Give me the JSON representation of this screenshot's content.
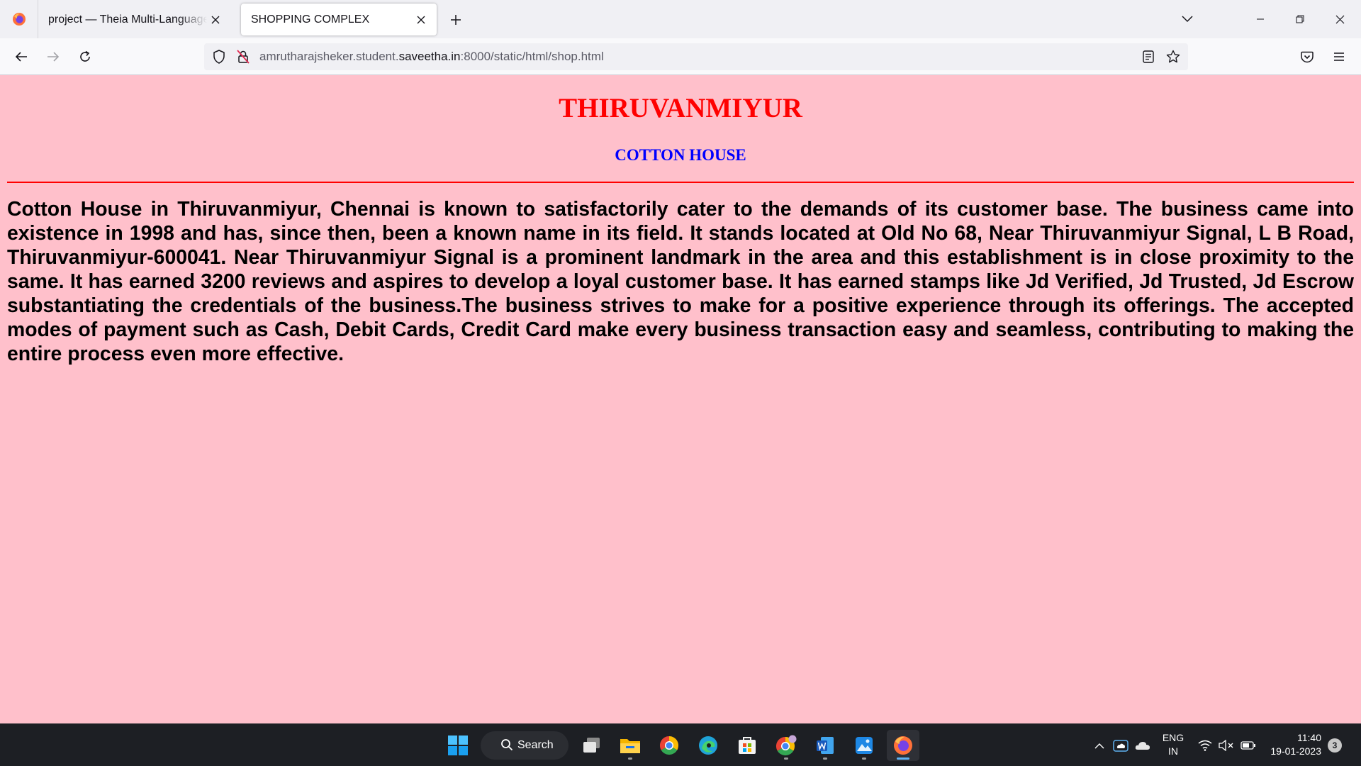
{
  "browser": {
    "tabs": [
      {
        "label": "project — Theia Multi-Language Ex",
        "active": false
      },
      {
        "label": "SHOPPING COMPLEX",
        "active": true
      }
    ],
    "url": {
      "prefix": "amrutharajsheker.student.",
      "domain": "saveetha.in",
      "suffix": ":8000/static/html/shop.html"
    }
  },
  "page": {
    "heading": "THIRUVANMIYUR",
    "subheading": "COTTON HOUSE",
    "body": "Cotton House in Thiruvanmiyur, Chennai is known to satisfactorily cater to the demands of its customer base. The business came into existence in 1998 and has, since then, been a known name in its field. It stands located at Old No 68, Near Thiruvanmiyur Signal, L B Road, Thiruvanmiyur-600041. Near Thiruvanmiyur Signal is a prominent landmark in the area and this establishment is in close proximity to the same. It has earned 3200 reviews and aspires to develop a loyal customer base. It has earned stamps like Jd Verified, Jd Trusted, Jd Escrow substantiating the credentials of the business.The business strives to make for a positive experience through its offerings. The accepted modes of payment such as Cash, Debit Cards, Credit Card make every business transaction easy and seamless, contributing to making the entire process even more effective.",
    "colors": {
      "background": "#ffc0cb",
      "heading": "#ff0000",
      "subheading": "#0000ff",
      "rule": "#ff0000"
    }
  },
  "taskbar": {
    "search_label": "Search",
    "apps": [
      "start-icon",
      "task-view-icon",
      "file-explorer-icon",
      "chrome-icon",
      "edge-icon",
      "microsoft-store-icon",
      "chrome-profile-icon",
      "word-icon",
      "photos-icon",
      "firefox-icon"
    ],
    "tray": {
      "language_line1": "ENG",
      "language_line2": "IN",
      "time": "11:40",
      "date": "19-01-2023",
      "notification_count": "3"
    }
  }
}
